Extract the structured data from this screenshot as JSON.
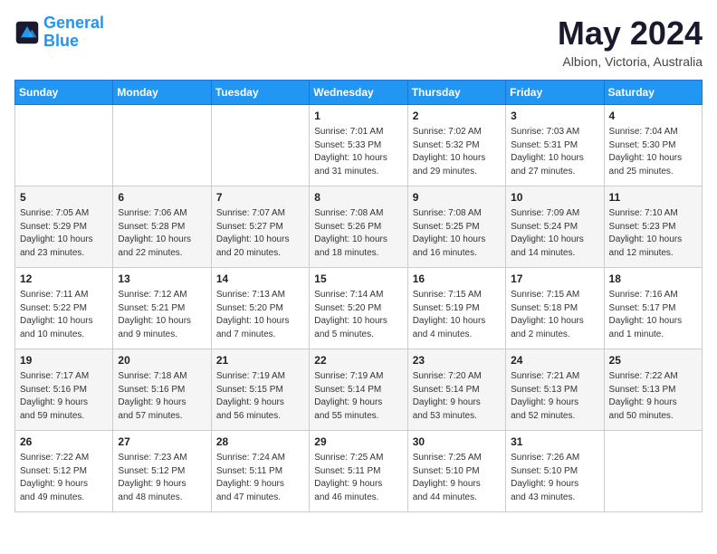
{
  "header": {
    "logo_line1": "General",
    "logo_line2": "Blue",
    "month": "May 2024",
    "location": "Albion, Victoria, Australia"
  },
  "weekdays": [
    "Sunday",
    "Monday",
    "Tuesday",
    "Wednesday",
    "Thursday",
    "Friday",
    "Saturday"
  ],
  "weeks": [
    [
      {
        "day": "",
        "info": ""
      },
      {
        "day": "",
        "info": ""
      },
      {
        "day": "",
        "info": ""
      },
      {
        "day": "1",
        "info": "Sunrise: 7:01 AM\nSunset: 5:33 PM\nDaylight: 10 hours\nand 31 minutes."
      },
      {
        "day": "2",
        "info": "Sunrise: 7:02 AM\nSunset: 5:32 PM\nDaylight: 10 hours\nand 29 minutes."
      },
      {
        "day": "3",
        "info": "Sunrise: 7:03 AM\nSunset: 5:31 PM\nDaylight: 10 hours\nand 27 minutes."
      },
      {
        "day": "4",
        "info": "Sunrise: 7:04 AM\nSunset: 5:30 PM\nDaylight: 10 hours\nand 25 minutes."
      }
    ],
    [
      {
        "day": "5",
        "info": "Sunrise: 7:05 AM\nSunset: 5:29 PM\nDaylight: 10 hours\nand 23 minutes."
      },
      {
        "day": "6",
        "info": "Sunrise: 7:06 AM\nSunset: 5:28 PM\nDaylight: 10 hours\nand 22 minutes."
      },
      {
        "day": "7",
        "info": "Sunrise: 7:07 AM\nSunset: 5:27 PM\nDaylight: 10 hours\nand 20 minutes."
      },
      {
        "day": "8",
        "info": "Sunrise: 7:08 AM\nSunset: 5:26 PM\nDaylight: 10 hours\nand 18 minutes."
      },
      {
        "day": "9",
        "info": "Sunrise: 7:08 AM\nSunset: 5:25 PM\nDaylight: 10 hours\nand 16 minutes."
      },
      {
        "day": "10",
        "info": "Sunrise: 7:09 AM\nSunset: 5:24 PM\nDaylight: 10 hours\nand 14 minutes."
      },
      {
        "day": "11",
        "info": "Sunrise: 7:10 AM\nSunset: 5:23 PM\nDaylight: 10 hours\nand 12 minutes."
      }
    ],
    [
      {
        "day": "12",
        "info": "Sunrise: 7:11 AM\nSunset: 5:22 PM\nDaylight: 10 hours\nand 10 minutes."
      },
      {
        "day": "13",
        "info": "Sunrise: 7:12 AM\nSunset: 5:21 PM\nDaylight: 10 hours\nand 9 minutes."
      },
      {
        "day": "14",
        "info": "Sunrise: 7:13 AM\nSunset: 5:20 PM\nDaylight: 10 hours\nand 7 minutes."
      },
      {
        "day": "15",
        "info": "Sunrise: 7:14 AM\nSunset: 5:20 PM\nDaylight: 10 hours\nand 5 minutes."
      },
      {
        "day": "16",
        "info": "Sunrise: 7:15 AM\nSunset: 5:19 PM\nDaylight: 10 hours\nand 4 minutes."
      },
      {
        "day": "17",
        "info": "Sunrise: 7:15 AM\nSunset: 5:18 PM\nDaylight: 10 hours\nand 2 minutes."
      },
      {
        "day": "18",
        "info": "Sunrise: 7:16 AM\nSunset: 5:17 PM\nDaylight: 10 hours\nand 1 minute."
      }
    ],
    [
      {
        "day": "19",
        "info": "Sunrise: 7:17 AM\nSunset: 5:16 PM\nDaylight: 9 hours\nand 59 minutes."
      },
      {
        "day": "20",
        "info": "Sunrise: 7:18 AM\nSunset: 5:16 PM\nDaylight: 9 hours\nand 57 minutes."
      },
      {
        "day": "21",
        "info": "Sunrise: 7:19 AM\nSunset: 5:15 PM\nDaylight: 9 hours\nand 56 minutes."
      },
      {
        "day": "22",
        "info": "Sunrise: 7:19 AM\nSunset: 5:14 PM\nDaylight: 9 hours\nand 55 minutes."
      },
      {
        "day": "23",
        "info": "Sunrise: 7:20 AM\nSunset: 5:14 PM\nDaylight: 9 hours\nand 53 minutes."
      },
      {
        "day": "24",
        "info": "Sunrise: 7:21 AM\nSunset: 5:13 PM\nDaylight: 9 hours\nand 52 minutes."
      },
      {
        "day": "25",
        "info": "Sunrise: 7:22 AM\nSunset: 5:13 PM\nDaylight: 9 hours\nand 50 minutes."
      }
    ],
    [
      {
        "day": "26",
        "info": "Sunrise: 7:22 AM\nSunset: 5:12 PM\nDaylight: 9 hours\nand 49 minutes."
      },
      {
        "day": "27",
        "info": "Sunrise: 7:23 AM\nSunset: 5:12 PM\nDaylight: 9 hours\nand 48 minutes."
      },
      {
        "day": "28",
        "info": "Sunrise: 7:24 AM\nSunset: 5:11 PM\nDaylight: 9 hours\nand 47 minutes."
      },
      {
        "day": "29",
        "info": "Sunrise: 7:25 AM\nSunset: 5:11 PM\nDaylight: 9 hours\nand 46 minutes."
      },
      {
        "day": "30",
        "info": "Sunrise: 7:25 AM\nSunset: 5:10 PM\nDaylight: 9 hours\nand 44 minutes."
      },
      {
        "day": "31",
        "info": "Sunrise: 7:26 AM\nSunset: 5:10 PM\nDaylight: 9 hours\nand 43 minutes."
      },
      {
        "day": "",
        "info": ""
      }
    ]
  ]
}
